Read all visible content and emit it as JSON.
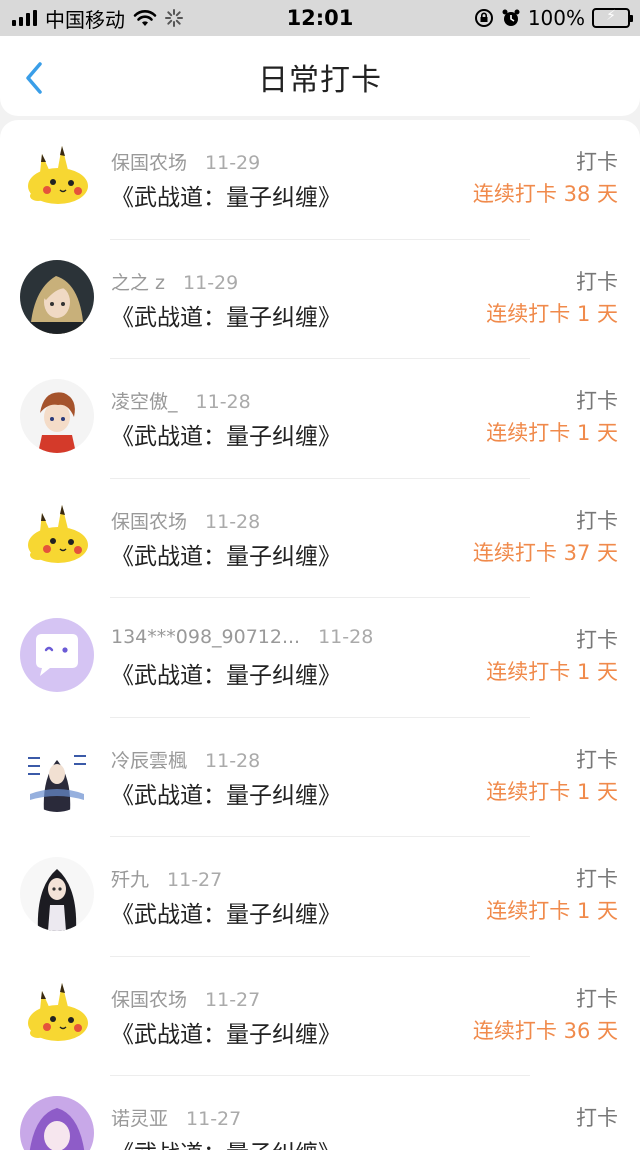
{
  "status_bar": {
    "carrier": "中国移动",
    "time": "12:01",
    "battery_percent": "100%",
    "battery_level": 1.0,
    "icons": [
      "signal-icon",
      "wifi-icon",
      "loading-icon",
      "orientation-lock-icon",
      "alarm-icon",
      "battery-charging-icon"
    ]
  },
  "nav": {
    "title": "日常打卡",
    "back_icon": "chevron-left-icon"
  },
  "colors": {
    "accent": "#f08a4b",
    "back_icon": "#3a9ee8",
    "status_bar_bg": "#d9d9d9"
  },
  "items": [
    {
      "user": "保国农场",
      "date": "11-29",
      "book": "《武战道：量子纠缠》",
      "type": "打卡",
      "streak": "连续打卡 38 天",
      "avatar": "pikachu-avatar"
    },
    {
      "user": "之之 z",
      "date": "11-29",
      "book": "《武战道：量子纠缠》",
      "type": "打卡",
      "streak": "连续打卡 1 天",
      "avatar": "anime-girl-avatar"
    },
    {
      "user": "凌空傲_",
      "date": "11-28",
      "book": "《武战道：量子纠缠》",
      "type": "打卡",
      "streak": "连续打卡 1 天",
      "avatar": "anime-boy-avatar"
    },
    {
      "user": "保国农场",
      "date": "11-28",
      "book": "《武战道：量子纠缠》",
      "type": "打卡",
      "streak": "连续打卡 37 天",
      "avatar": "pikachu-avatar"
    },
    {
      "user": "134***098_90712...",
      "date": "11-28",
      "book": "《武战道：量子纠缠》",
      "type": "打卡",
      "streak": "连续打卡 1 天",
      "avatar": "default-chat-avatar"
    },
    {
      "user": "冷辰雲楓",
      "date": "11-28",
      "book": "《武战道：量子纠缠》",
      "type": "打卡",
      "streak": "连续打卡 1 天",
      "avatar": "ink-character-avatar"
    },
    {
      "user": "歼九",
      "date": "11-27",
      "book": "《武战道：量子纠缠》",
      "type": "打卡",
      "streak": "连续打卡 1 天",
      "avatar": "dark-hair-girl-avatar"
    },
    {
      "user": "保国农场",
      "date": "11-27",
      "book": "《武战道：量子纠缠》",
      "type": "打卡",
      "streak": "连续打卡 36 天",
      "avatar": "pikachu-avatar"
    },
    {
      "user": "诺灵亚",
      "date": "11-27",
      "book": "《武战道：量子纠缠》",
      "type": "打卡",
      "streak": "",
      "avatar": "purple-anime-avatar"
    }
  ]
}
